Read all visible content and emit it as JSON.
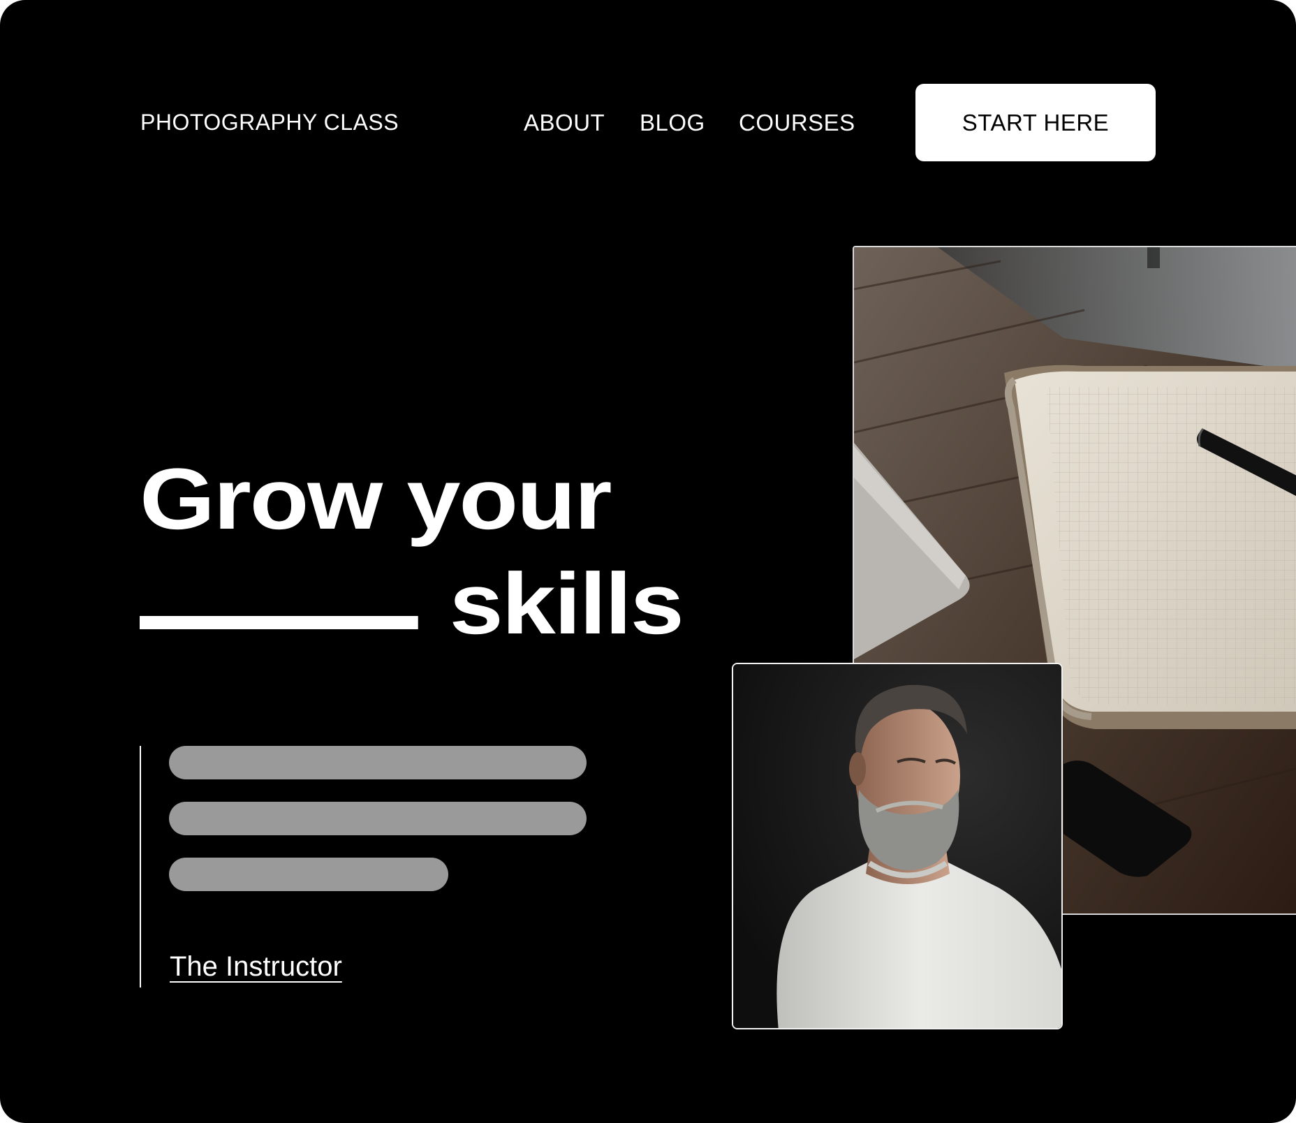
{
  "header": {
    "brand": "PHOTOGRAPHY CLASS",
    "nav": [
      {
        "label": "ABOUT"
      },
      {
        "label": "BLOG"
      },
      {
        "label": "COURSES"
      }
    ],
    "cta_label": "START HERE"
  },
  "hero": {
    "title_line1": "Grow your",
    "title_line2_word": "skills"
  },
  "testimonial": {
    "author_link": "The Instructor"
  },
  "images": {
    "desk": "desk-notebook-photo",
    "portrait": "instructor-portrait-photo"
  },
  "colors": {
    "background": "#000000",
    "text": "#ffffff",
    "placeholder": "#9a9a9a",
    "button_bg": "#ffffff"
  }
}
